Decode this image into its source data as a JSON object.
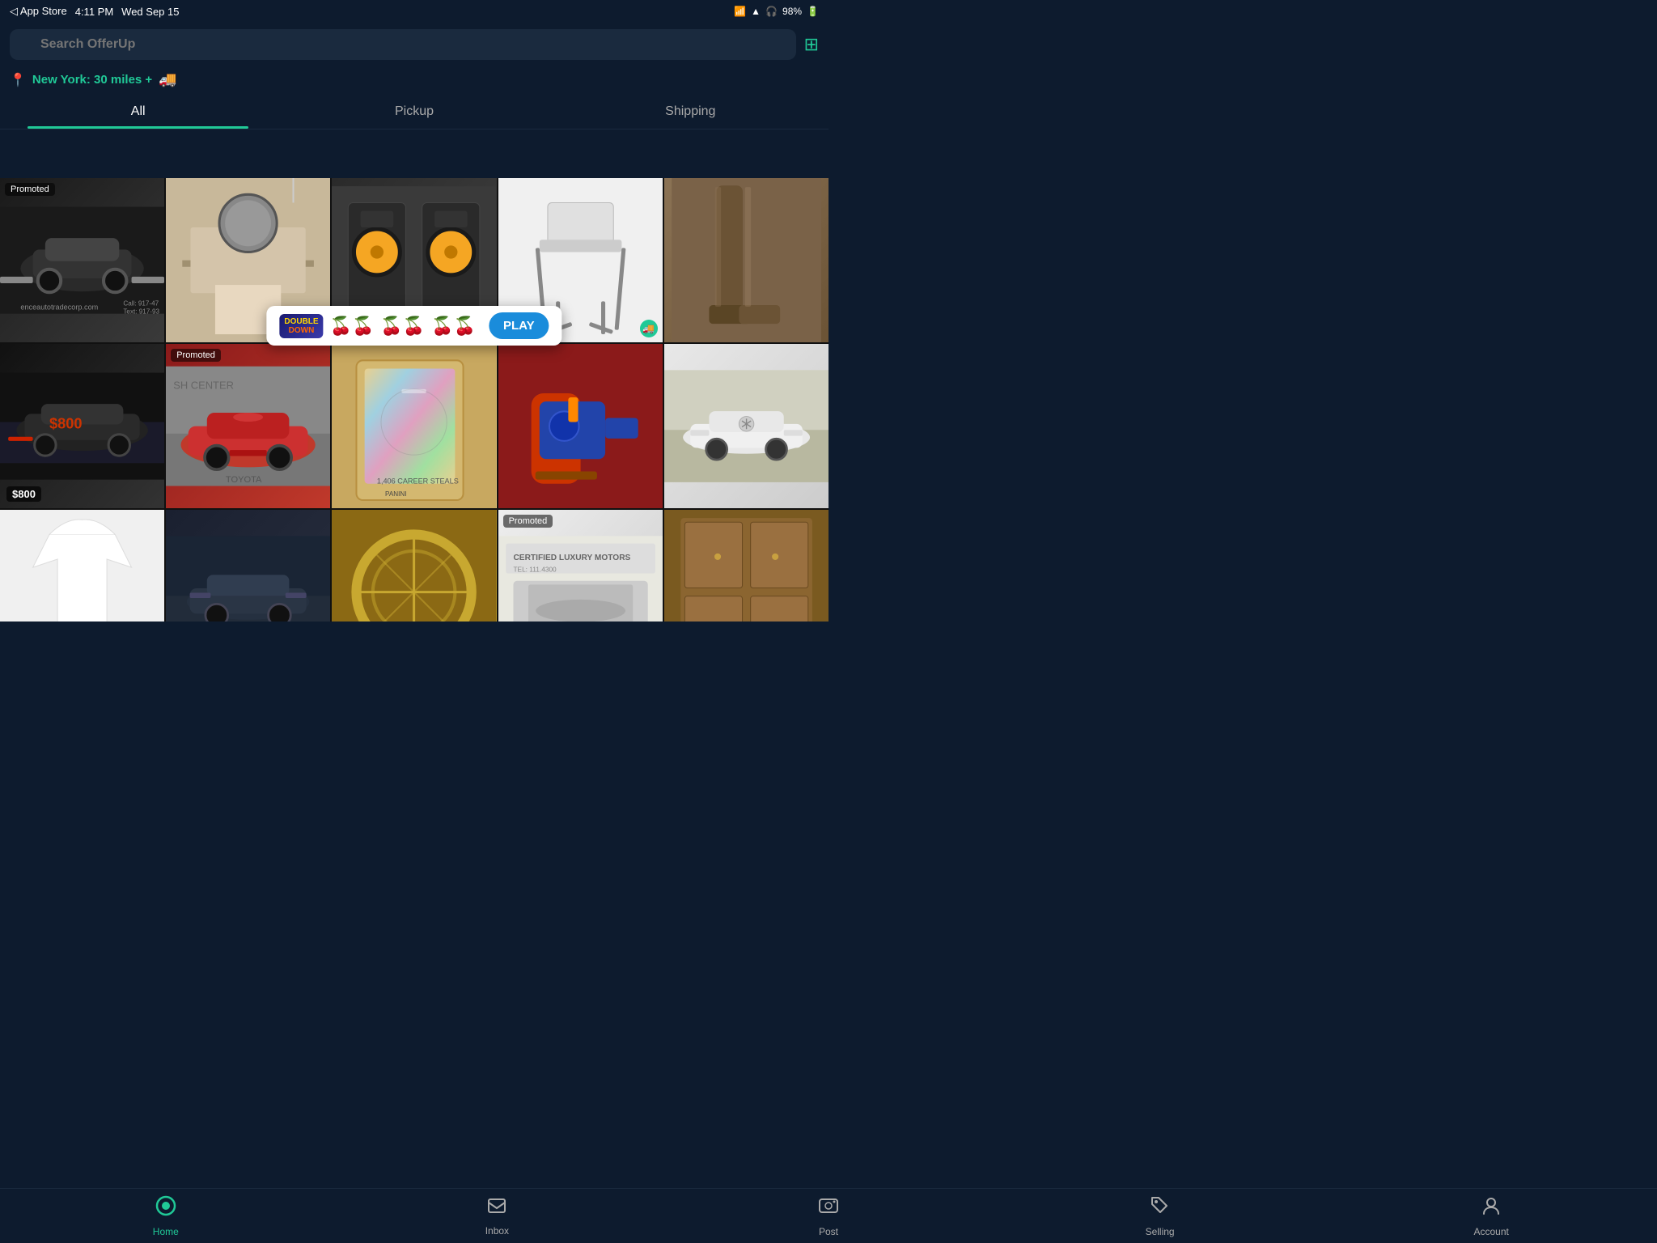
{
  "statusBar": {
    "appStore": "◁ App Store",
    "time": "4:11 PM",
    "date": "Wed Sep 15",
    "wifi": "WiFi",
    "location": "▲",
    "headphones": "🎧",
    "battery": "98%"
  },
  "search": {
    "placeholder": "Search OfferUp",
    "brandName": "OfferUp"
  },
  "location": {
    "text": "New York: 30 miles +",
    "deliveryIcon": "🚚"
  },
  "tabs": [
    {
      "id": "all",
      "label": "All",
      "active": true
    },
    {
      "id": "pickup",
      "label": "Pickup",
      "active": false
    },
    {
      "id": "shipping",
      "label": "Shipping",
      "active": false
    }
  ],
  "ad": {
    "logoLine1": "DOUBLE",
    "logoLine2": "DOWN",
    "cherries": "🍒🍒🍒",
    "playLabel": "PLAY"
  },
  "gridItems": [
    {
      "id": 1,
      "type": "car-black",
      "badge": "Promoted",
      "hasShipping": false,
      "price": null,
      "label": "Black SUV car"
    },
    {
      "id": 2,
      "type": "room",
      "badge": null,
      "hasShipping": false,
      "price": null,
      "label": "Bedroom furniture"
    },
    {
      "id": 3,
      "type": "speakers",
      "badge": null,
      "hasShipping": false,
      "price": null,
      "label": "KRK studio monitors"
    },
    {
      "id": 4,
      "type": "highchair",
      "badge": null,
      "hasShipping": true,
      "price": null,
      "label": "Baby high chair"
    },
    {
      "id": 5,
      "type": "boots",
      "badge": null,
      "hasShipping": false,
      "price": null,
      "label": "Brown boots"
    },
    {
      "id": 6,
      "type": "car-dark",
      "badge": null,
      "hasShipping": false,
      "price": "$800",
      "label": "Dark sedan"
    },
    {
      "id": 7,
      "type": "toyota",
      "badge": "Promoted",
      "hasShipping": false,
      "price": null,
      "label": "Red Toyota SUV"
    },
    {
      "id": 8,
      "type": "baseball",
      "badge": null,
      "hasShipping": false,
      "price": null,
      "label": "Baseball card holographic"
    },
    {
      "id": 9,
      "type": "nerf",
      "badge": null,
      "hasShipping": false,
      "price": null,
      "label": "Nerf gun on red couch"
    },
    {
      "id": 10,
      "type": "mercedes",
      "badge": null,
      "hasShipping": false,
      "price": null,
      "label": "White Mercedes"
    },
    {
      "id": 11,
      "type": "tshirt",
      "badge": null,
      "hasShipping": false,
      "price": null,
      "label": "White t-shirt"
    },
    {
      "id": 12,
      "type": "car-dark2",
      "badge": null,
      "hasShipping": false,
      "price": null,
      "label": "Dark blue car"
    },
    {
      "id": 13,
      "type": "circle",
      "badge": null,
      "hasShipping": false,
      "price": null,
      "label": "Decorative circle frame"
    },
    {
      "id": 14,
      "type": "luxury",
      "badge": "Promoted",
      "hasShipping": false,
      "price": null,
      "label": "Luxury Motors"
    },
    {
      "id": 15,
      "type": "cabinet",
      "badge": null,
      "hasShipping": false,
      "price": null,
      "label": "Wooden cabinet"
    }
  ],
  "bottomNav": [
    {
      "id": "home",
      "label": "Home",
      "icon": "⊙",
      "active": true
    },
    {
      "id": "inbox",
      "label": "Inbox",
      "icon": "💬",
      "active": false
    },
    {
      "id": "post",
      "label": "Post",
      "icon": "📷",
      "active": false
    },
    {
      "id": "selling",
      "label": "Selling",
      "icon": "🏷",
      "active": false
    },
    {
      "id": "account",
      "label": "Account",
      "icon": "👤",
      "active": false
    }
  ],
  "colors": {
    "primary": "#20c997",
    "background": "#0d1b2e",
    "cardBg": "#1a2a3e"
  }
}
